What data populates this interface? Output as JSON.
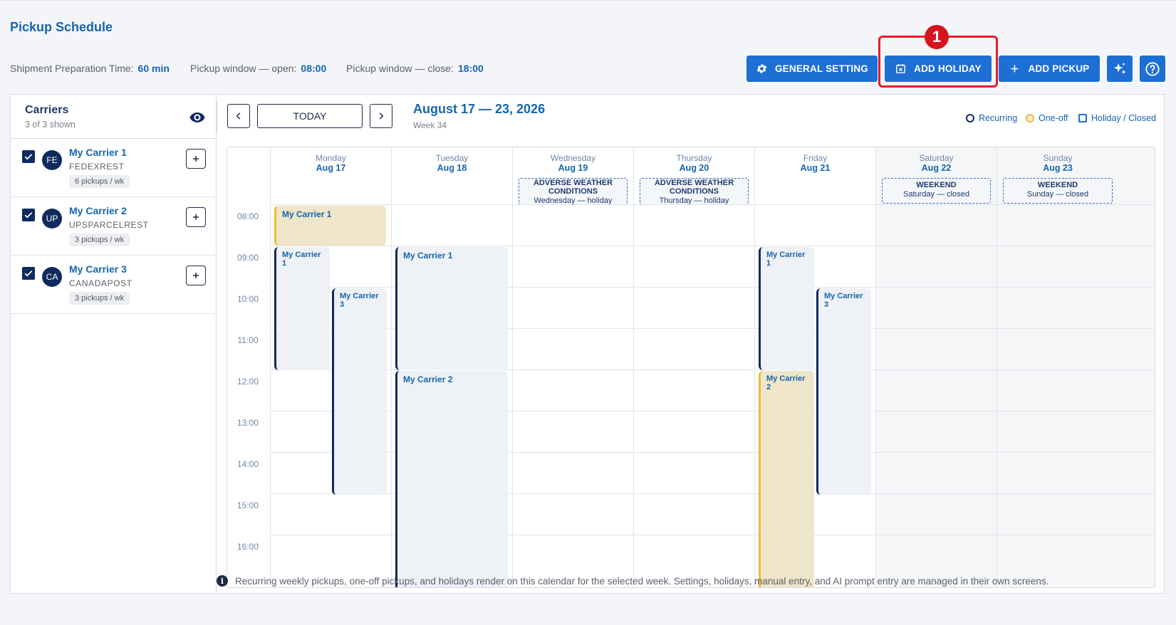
{
  "page": {
    "title": "Pickup Schedule"
  },
  "meta": {
    "prep_label": "Shipment Preparation Time:",
    "prep_value": "60 min",
    "open_label": "Pickup window — open:",
    "open_value": "08:00",
    "close_label": "Pickup window — close:",
    "close_value": "18:00"
  },
  "toolbar": {
    "general_setting": "GENERAL SETTING",
    "add_holiday": "ADD HOLIDAY",
    "add_pickup": "ADD PICKUP",
    "step_number": "1"
  },
  "carriers": {
    "title": "Carriers",
    "subtitle": "3 of 3 shown",
    "items": [
      {
        "initials": "FE",
        "name": "My Carrier 1",
        "code": "FEDEXREST",
        "badge": "6 pickups / wk",
        "checked": true
      },
      {
        "initials": "UP",
        "name": "My Carrier 2",
        "code": "UPSPARCELREST",
        "badge": "3 pickups / wk",
        "checked": true
      },
      {
        "initials": "CA",
        "name": "My Carrier 3",
        "code": "CANADAPOST",
        "badge": "3 pickups / wk",
        "checked": true
      }
    ]
  },
  "calendar": {
    "today_label": "TODAY",
    "range": "August 17 — 23, 2026",
    "week": "Week 34",
    "legend": {
      "recurring": "Recurring",
      "oneoff": "One-off",
      "holiday": "Holiday / Closed"
    },
    "days": [
      {
        "name": "Monday",
        "date": "Aug 17"
      },
      {
        "name": "Tuesday",
        "date": "Aug 18"
      },
      {
        "name": "Wednesday",
        "date": "Aug 19",
        "banner_title": "ADVERSE WEATHER CONDITIONS",
        "banner_sub": "Wednesday — holiday"
      },
      {
        "name": "Thursday",
        "date": "Aug 20",
        "banner_title": "ADVERSE WEATHER CONDITIONS",
        "banner_sub": "Thursday — holiday"
      },
      {
        "name": "Friday",
        "date": "Aug 21"
      },
      {
        "name": "Saturday",
        "date": "Aug 22",
        "banner_title": "WEEKEND",
        "banner_sub": "Saturday — closed"
      },
      {
        "name": "Sunday",
        "date": "Aug 23",
        "banner_title": "WEEKEND",
        "banner_sub": "Sunday — closed"
      }
    ],
    "times": [
      "08:00",
      "09:00",
      "10:00",
      "11:00",
      "12:00",
      "13:00",
      "14:00",
      "15:00",
      "16:00"
    ],
    "events": [
      {
        "label": "My Carrier 1",
        "kind": "one-off",
        "day": "Monday",
        "start": "08:00",
        "end": "09:00"
      },
      {
        "label": "My Carrier 1",
        "kind": "recurring",
        "day": "Monday",
        "start": "09:00",
        "end": "12:00"
      },
      {
        "label": "My Carrier 3",
        "kind": "recurring",
        "day": "Monday",
        "start": "10:00",
        "end": "15:00"
      },
      {
        "label": "My Carrier 1",
        "kind": "recurring",
        "day": "Tuesday",
        "start": "09:00",
        "end": "12:00"
      },
      {
        "label": "My Carrier 2",
        "kind": "recurring",
        "day": "Tuesday",
        "start": "12:00",
        "end": ""
      },
      {
        "label": "My Carrier 1",
        "kind": "recurring",
        "day": "Friday",
        "start": "09:00",
        "end": "12:00"
      },
      {
        "label": "My Carrier 3",
        "kind": "recurring",
        "day": "Friday",
        "start": "10:00",
        "end": "15:00"
      },
      {
        "label": "My Carrier 2",
        "kind": "one-off",
        "day": "Friday",
        "start": "12:00",
        "end": ""
      }
    ]
  },
  "footer": {
    "note": "Recurring weekly pickups, one-off pickups, and holidays render on this calendar for the selected week. Settings, holidays, manual entry, and AI prompt entry are managed in their own screens."
  },
  "colors": {
    "accent": "#1e6fd4",
    "navy": "#0f2a5e",
    "oneoff": "#efb938",
    "highlight": "#e11d2a"
  }
}
